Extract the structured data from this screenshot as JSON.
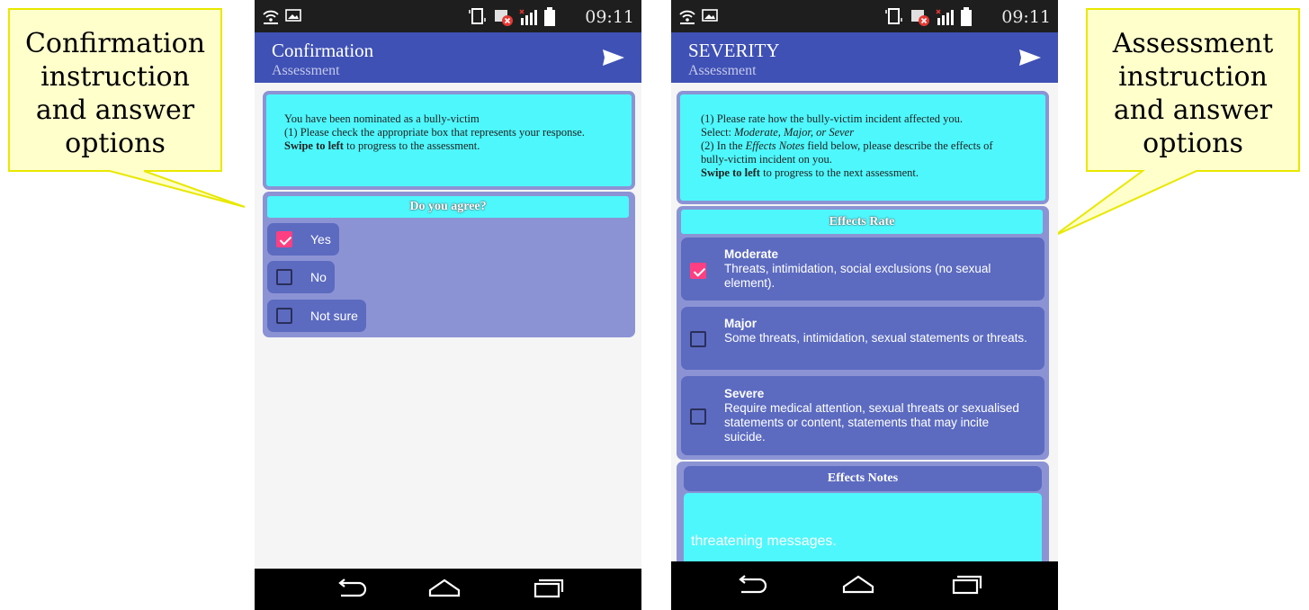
{
  "callouts": {
    "left": [
      "Confirmation",
      "instruction",
      "and answer",
      "options"
    ],
    "right": [
      "Assessment",
      "instruction",
      "and answer",
      "options"
    ],
    "fill": "#ffffcc",
    "stroke": "#e8e800"
  },
  "status": {
    "time": "09:11"
  },
  "left_screen": {
    "title": "Confirmation",
    "subtitle": "Assessment",
    "instructions": {
      "line1": "You have been nominated as a bully-victim",
      "line2": "(1) Please check the appropriate box that represents your response.",
      "line3_bold": "Swipe to left",
      "line3_rest": " to progress to the assessment."
    },
    "question": "Do you agree?",
    "options": [
      {
        "label": "Yes",
        "checked": true
      },
      {
        "label": "No",
        "checked": false
      },
      {
        "label": "Not sure",
        "checked": false
      }
    ]
  },
  "right_screen": {
    "title": "SEVERITY",
    "subtitle": "Assessment",
    "instructions": {
      "p1": "(1) Please rate how the bully-victim incident affected you.",
      "p2_prefix": "Select: ",
      "p2_italic": "Moderate, Major, or Sever",
      "p3_prefix": "(2) In the ",
      "p3_italic": "Effects Notes",
      "p3_rest": " field below, please describe the effects of bully-victim incident on you.",
      "p4_bold": "Swipe to left",
      "p4_rest": " to progress to the next assessment."
    },
    "rate_header": "Effects Rate",
    "options": [
      {
        "title": "Moderate",
        "desc": "Threats, intimidation, social exclusions (no sexual element).",
        "checked": true
      },
      {
        "title": "Major",
        "desc": "Some threats, intimidation, sexual statements or threats.",
        "checked": false
      },
      {
        "title": "Severe",
        "desc": "Require medical attention, sexual threats or sexualised statements or content, statements that may incite suicide.",
        "checked": false
      }
    ],
    "notes_header": "Effects Notes",
    "notes_value": "threatening messages."
  },
  "colors": {
    "appbar": "#3f51b5",
    "cyan": "#4ef7fc",
    "group": "#8c93d4",
    "option": "#5c6bc0",
    "check": "#ff3f81"
  }
}
